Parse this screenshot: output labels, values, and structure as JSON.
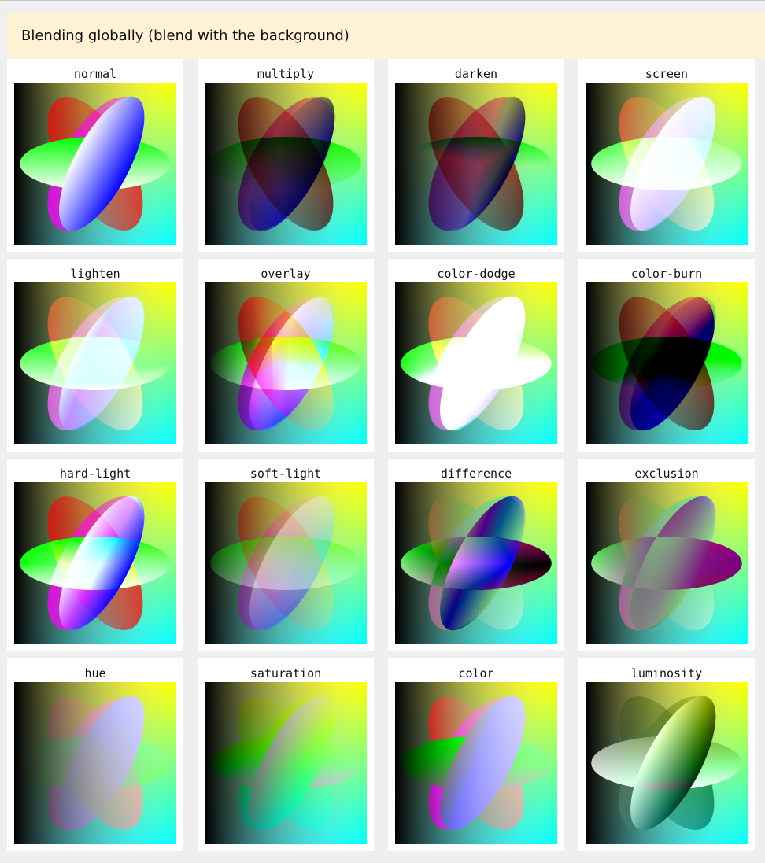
{
  "header": {
    "title": "Blending globally (blend with the background)"
  },
  "modes": [
    {
      "label": "normal",
      "mode": "normal"
    },
    {
      "label": "multiply",
      "mode": "multiply"
    },
    {
      "label": "darken",
      "mode": "darken"
    },
    {
      "label": "screen",
      "mode": "screen"
    },
    {
      "label": "lighten",
      "mode": "lighten"
    },
    {
      "label": "overlay",
      "mode": "overlay"
    },
    {
      "label": "color-dodge",
      "mode": "color-dodge"
    },
    {
      "label": "color-burn",
      "mode": "color-burn"
    },
    {
      "label": "hard-light",
      "mode": "hard-light"
    },
    {
      "label": "soft-light",
      "mode": "soft-light"
    },
    {
      "label": "difference",
      "mode": "difference"
    },
    {
      "label": "exclusion",
      "mode": "exclusion"
    },
    {
      "label": "hue",
      "mode": "hue"
    },
    {
      "label": "saturation",
      "mode": "saturation"
    },
    {
      "label": "color",
      "mode": "color"
    },
    {
      "label": "luminosity",
      "mode": "luminosity"
    }
  ],
  "colors": {
    "banner_bg": "#fff2d5",
    "page_bg": "#efefef",
    "red_shape": "#ff0000",
    "green_shape": "#00ff00",
    "blue_shape": "#0000ff",
    "magenta_shape": "#ff00ff"
  }
}
